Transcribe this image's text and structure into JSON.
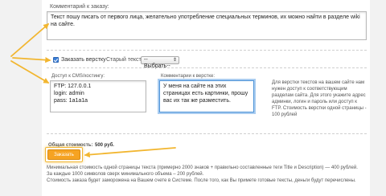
{
  "comment": {
    "label": "Комментарий к заказу:",
    "value": "Текст пошу писать от первого лица, желательно употребление специальных терминов, их можно найти в разделе wiki на сайте."
  },
  "layout_check": {
    "label": "Заказать верстку",
    "checked": true,
    "old_text_label": "Старый текст:",
    "old_text_select": "--Выбрать--"
  },
  "cms_access": {
    "label": "Доступ к CMS/хостингу:",
    "value": "FTP: 127.0.0.1\nlogin: admin\npass: 1a1a1a"
  },
  "layout_comment": {
    "label": "Комментарии к верстке:",
    "value": "У меня на сайте на этих страницах есть картинки, прошу вас их так же разместить."
  },
  "info_text": "Для верстки текстов на вашем сайте нам нужен доступ к соответствующим разделам сайта. Для этого укажите адрес админки, логин и пароль или доступ к FTP. Стоимость верстки одной страницы - 100 рублей",
  "total": {
    "label": "Общая стоимость:",
    "value": "500 руб."
  },
  "order_button": "Заказать",
  "footer": {
    "line1": "Минимальная стоимость одной страницы текста (примерно 2000 знаков + правильно составленные теги Title и Description) — 400 рублей.",
    "line2": "За каждые 1000 символов сверх минимального объема – 200 рублей.",
    "line3": "Стоимость заказа будет заморожена на Вашем счете в Системе. После того, как Вы примете готовые тексты, деньги будут перечислены."
  },
  "colors": {
    "arrow": "#f2b630",
    "button": "#f6a322",
    "focus": "#4f94d8",
    "checkbox": "#3b7fd9"
  }
}
